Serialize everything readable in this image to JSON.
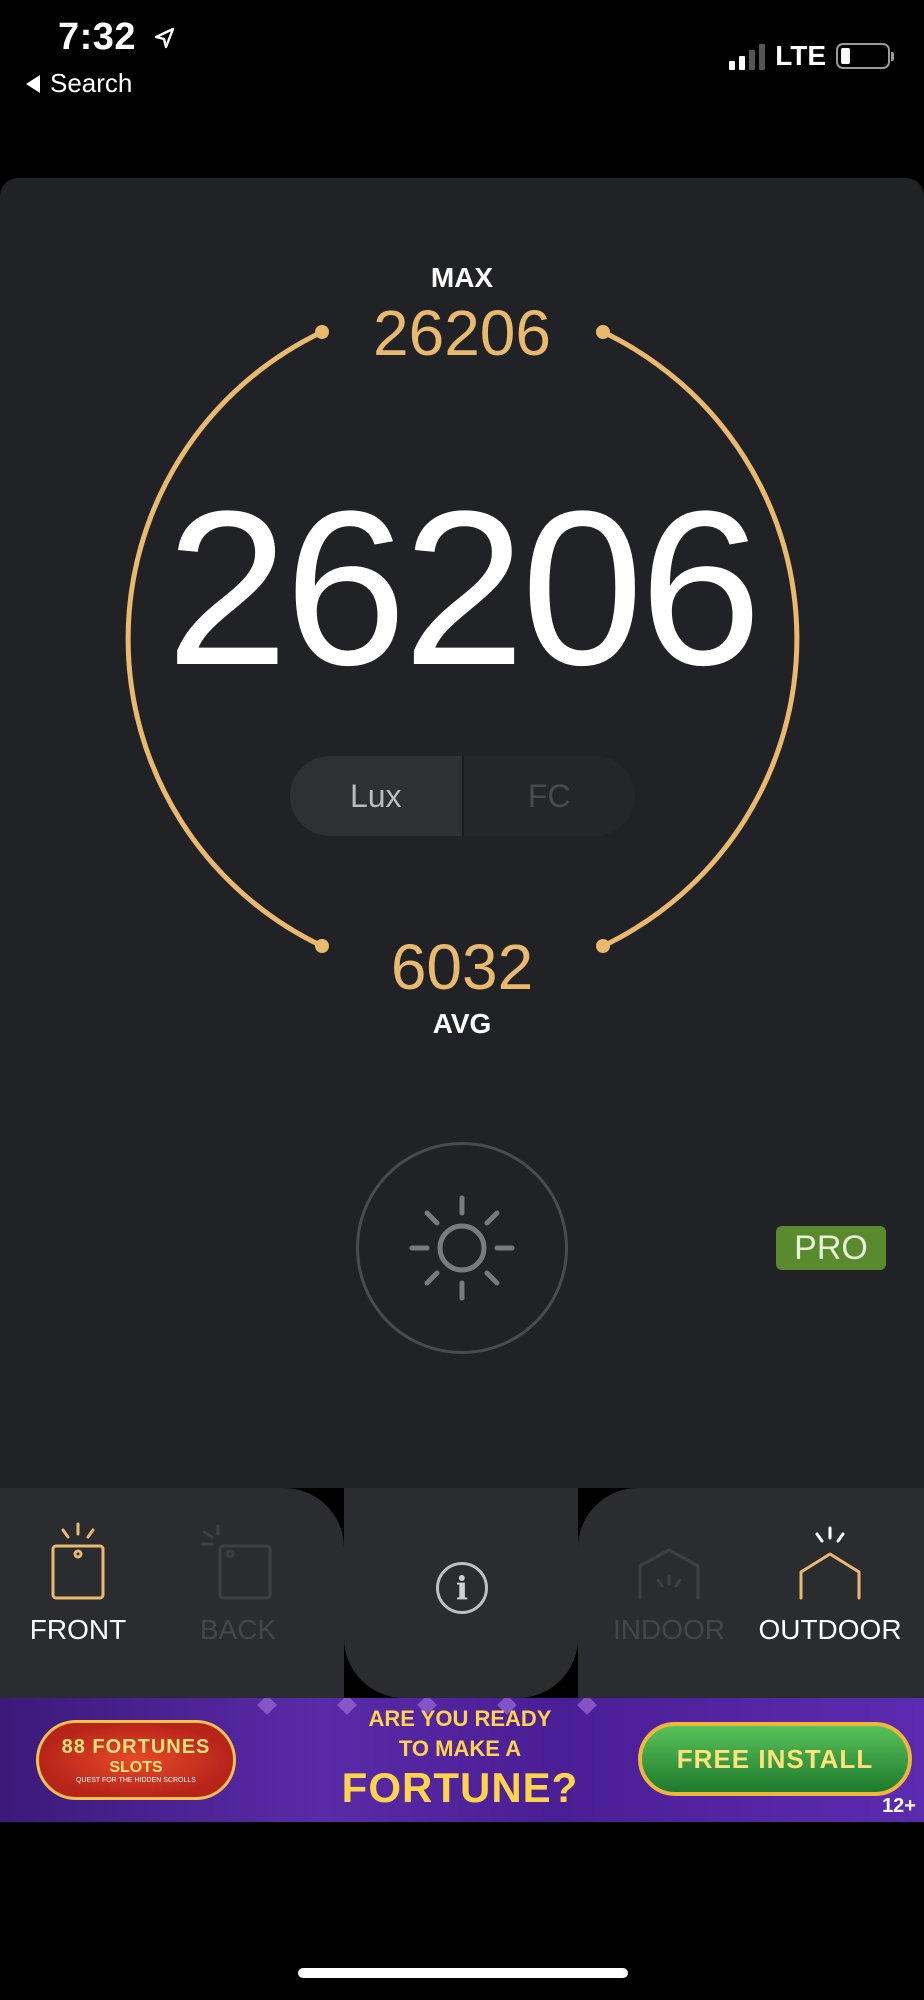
{
  "status_bar": {
    "time": "7:32",
    "back_label": "Search",
    "network": "LTE",
    "signal_bars_filled": 2,
    "signal_bars_total": 4,
    "battery_level": 0.15
  },
  "meter": {
    "max_label": "MAX",
    "max_value": "26206",
    "current_value": "26206",
    "avg_value": "6032",
    "avg_label": "AVG",
    "units": [
      {
        "label": "Lux",
        "selected": true
      },
      {
        "label": "FC",
        "selected": false
      }
    ],
    "accent_color": "#e9b96e"
  },
  "light_button": {
    "icon": "sun-icon"
  },
  "pro_badge": "PRO",
  "modes": {
    "camera": [
      {
        "label": "FRONT",
        "icon": "front-camera-icon",
        "selected": true
      },
      {
        "label": "BACK",
        "icon": "back-camera-icon",
        "selected": false
      }
    ],
    "environment": [
      {
        "label": "INDOOR",
        "icon": "indoor-icon",
        "selected": false
      },
      {
        "label": "OUTDOOR",
        "icon": "outdoor-icon",
        "selected": true
      }
    ],
    "info_icon": "info-icon"
  },
  "ad": {
    "logo_line1": "88 FORTUNES",
    "logo_line2": "SLOTS",
    "logo_tagline": "QUEST FOR THE HIDDEN SCROLLS",
    "headline_line1": "ARE YOU READY",
    "headline_line2": "TO MAKE A",
    "headline_line3": "FORTUNE?",
    "cta": "FREE INSTALL",
    "age_rating": "12+"
  }
}
